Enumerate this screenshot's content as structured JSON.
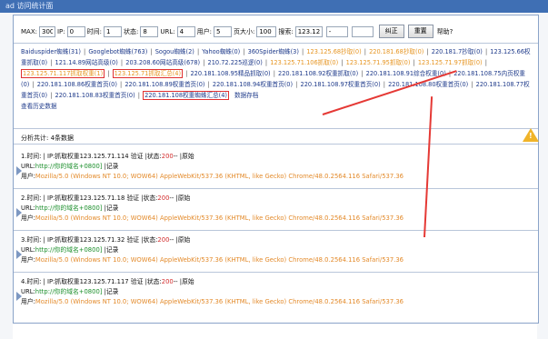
{
  "window": {
    "title": "ad 访问统计面"
  },
  "filter": {
    "max_label": "MAX:",
    "max_value": "300",
    "ip_label": "IP:",
    "ip_value": "0",
    "time_label": "时间:",
    "time_value": "1",
    "status_label": "状态:",
    "status_value": "8",
    "url_label": "URL:",
    "url_value": "4",
    "user_label": "用户:",
    "user_value": "5",
    "pagesize_label": "页大小:",
    "pagesize_value": "100",
    "search_label": "搜索:",
    "search_value": "123.12",
    "extra1_value": "-",
    "extra2_value": "",
    "confirm_label": "纠正",
    "reset_label": "重置",
    "help_label": "帮助?"
  },
  "links": [
    {
      "text": "Baiduspider蜘蛛(31)",
      "color": "blue"
    },
    {
      "text": "Googlebot蜘蛛(763)",
      "color": "blue"
    },
    {
      "text": "Sogou蜘蛛(2)",
      "color": "blue"
    },
    {
      "text": "Yahoo蜘蛛(0)",
      "color": "blue"
    },
    {
      "text": "360Spider蜘蛛(3)",
      "color": "blue"
    },
    {
      "text": "123.125.68抄取(0)",
      "color": "orange"
    },
    {
      "text": "220.181.68抄取(0)",
      "color": "orange"
    },
    {
      "text": "220.181.7抄取(0)",
      "color": "blue"
    },
    {
      "text": "123.125.66权重抓取(0)",
      "color": "blue"
    },
    {
      "text": "121.14.89网站高级(0)",
      "color": "blue"
    },
    {
      "text": "203.208.60网站高级(678)",
      "color": "blue"
    },
    {
      "text": "210.72.225巡逻(0)",
      "color": "blue"
    },
    {
      "text": "123.125.71.106抓取(0)",
      "color": "orange"
    },
    {
      "text": "123.125.71.95抓取(0)",
      "color": "orange"
    },
    {
      "text": "123.125.71.97抓取(0)",
      "color": "orange"
    },
    {
      "text": "123.125.71.117抓取权重(1)",
      "color": "orange",
      "boxed": true
    },
    {
      "text": "123.125.71抓取汇总(4)",
      "color": "orange",
      "boxed": true
    },
    {
      "text": "220.181.108.95精品抓取(0)",
      "color": "blue"
    },
    {
      "text": "220.181.108.92权重抓取(0)",
      "color": "blue"
    },
    {
      "text": "220.181.108.91综合权重(0)",
      "color": "blue"
    },
    {
      "text": "220.181.108.75内页权重(0)",
      "color": "blue"
    },
    {
      "text": "220.181.108.86权重首页(0)",
      "color": "blue"
    },
    {
      "text": "220.181.108.89权重首页(0)",
      "color": "blue"
    },
    {
      "text": "220.181.108.94权重首页(0)",
      "color": "blue"
    },
    {
      "text": "220.181.108.97权重首页(0)",
      "color": "blue"
    },
    {
      "text": "220.181.108.80权重首页(0)",
      "color": "blue"
    },
    {
      "text": "220.181.108.77权重首页(0)",
      "color": "blue"
    },
    {
      "text": "220.181.108.83权重首页(0)",
      "color": "blue"
    },
    {
      "text": "220.181.108权重蜘蛛汇总(4)",
      "color": "blue",
      "boxed": true
    }
  ],
  "extra_links": {
    "save": "数据存档",
    "history": "查看历史数据"
  },
  "summary": "分析共计: 4条数据",
  "records": [
    {
      "idx": "1.时间:",
      "ip": "IP:抓取权重123.125.71.114",
      "verify": "验证",
      "status_label": "状态:",
      "status": "200",
      "raw": "原始",
      "url_label": "URL:",
      "url": "http://你的域名+0800]",
      "log": "记录",
      "ua_label": "用户:",
      "ua": "Mozilla/5.0 (Windows NT 10.0; WOW64) AppleWebKit/537.36 (KHTML, like Gecko) Chrome/48.0.2564.116 Safari/537.36"
    },
    {
      "idx": "2.时间:",
      "ip": "IP:抓取权重123.125.71.18",
      "verify": "验证",
      "status_label": "状态:",
      "status": "200",
      "raw": "原始",
      "url_label": "URL:",
      "url": "http://你的域名+0800]",
      "log": "记录",
      "ua_label": "用户:",
      "ua": "Mozilla/5.0 (Windows NT 10.0; WOW64) AppleWebKit/537.36 (KHTML, like Gecko) Chrome/48.0.2564.116 Safari/537.36"
    },
    {
      "idx": "3.时间:",
      "ip": "IP:抓取权重123.125.71.32",
      "verify": "验证",
      "status_label": "状态:",
      "status": "200",
      "raw": "原始",
      "url_label": "URL:",
      "url": "http://你的域名+0800]",
      "log": "记录",
      "ua_label": "用户:",
      "ua": "Mozilla/5.0 (Windows NT 10.0; WOW64) AppleWebKit/537.36 (KHTML, like Gecko) Chrome/48.0.2564.116 Safari/537.36"
    },
    {
      "idx": "4.时间:",
      "ip": "IP:抓取权重123.125.71.117",
      "verify": "验证",
      "status_label": "状态:",
      "status": "200",
      "raw": "原始",
      "url_label": "URL:",
      "url": "http://你的域名+0800]",
      "log": "记录",
      "ua_label": "用户:",
      "ua": "Mozilla/5.0 (Windows NT 10.0; WOW64) AppleWebKit/537.36 (KHTML, like Gecko) Chrome/48.0.2564.116 Safari/537.36"
    }
  ],
  "colors": {
    "accent": "#1e3a8a",
    "orange": "#e69522",
    "highlight": "#e03030",
    "status_ok": "#d32f2f",
    "url": "#1c8f2c",
    "ua": "#e38a2a"
  },
  "icons": {
    "warning": "warning-icon"
  }
}
